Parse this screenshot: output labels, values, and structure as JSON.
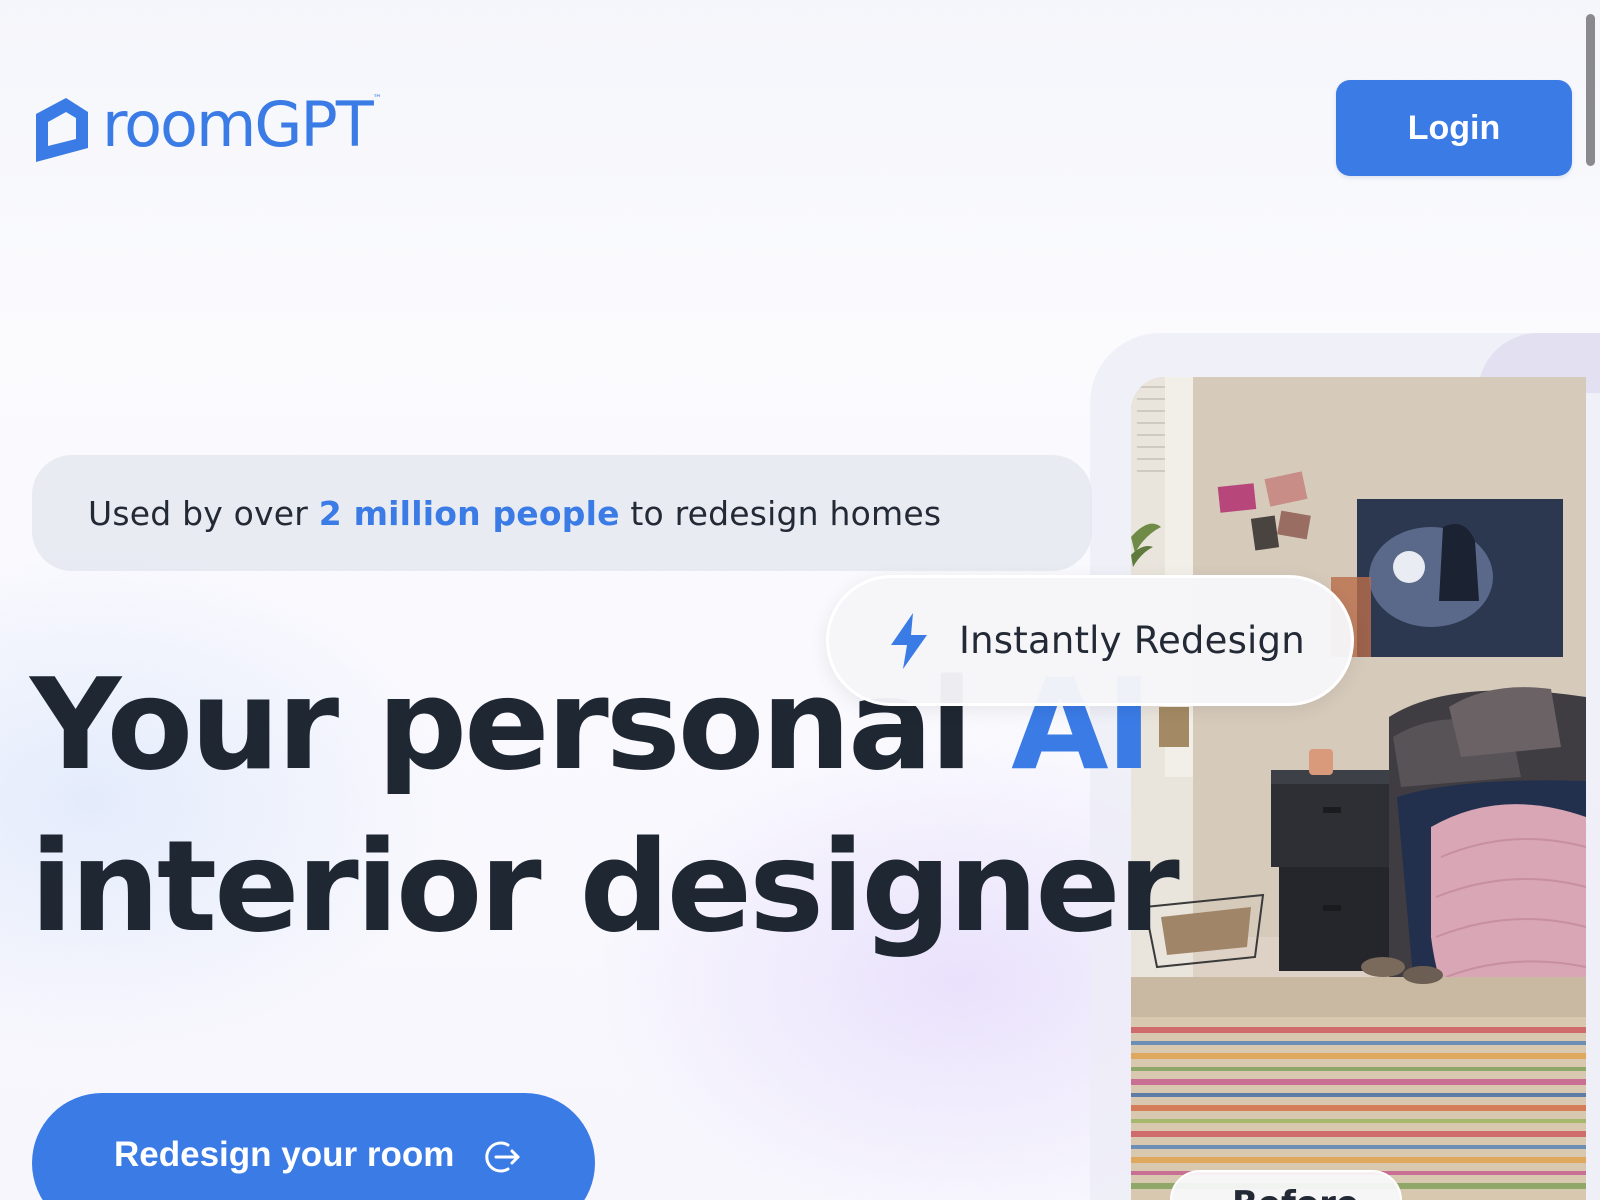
{
  "header": {
    "brand": "roomGPT",
    "trademark": "™",
    "login_label": "Login"
  },
  "hero": {
    "usage_prefix": "Used by over ",
    "usage_highlight": "2 million people",
    "usage_suffix": " to redesign homes",
    "title_line1_part1": "Your personal ",
    "title_line1_accent": "AI",
    "title_line2": "interior designer",
    "cta_label": "Redesign your room"
  },
  "showcase": {
    "badge_label": "Instantly Redesign",
    "before_label": "Before"
  },
  "icons": {
    "logo": "house-logo-icon",
    "cta": "arrow-right-circle-icon",
    "badge": "lightning-bolt-icon"
  },
  "colors": {
    "accent": "#3a7be6",
    "text_dark": "#1f2733",
    "pill_bg": "#e4e8f0"
  }
}
